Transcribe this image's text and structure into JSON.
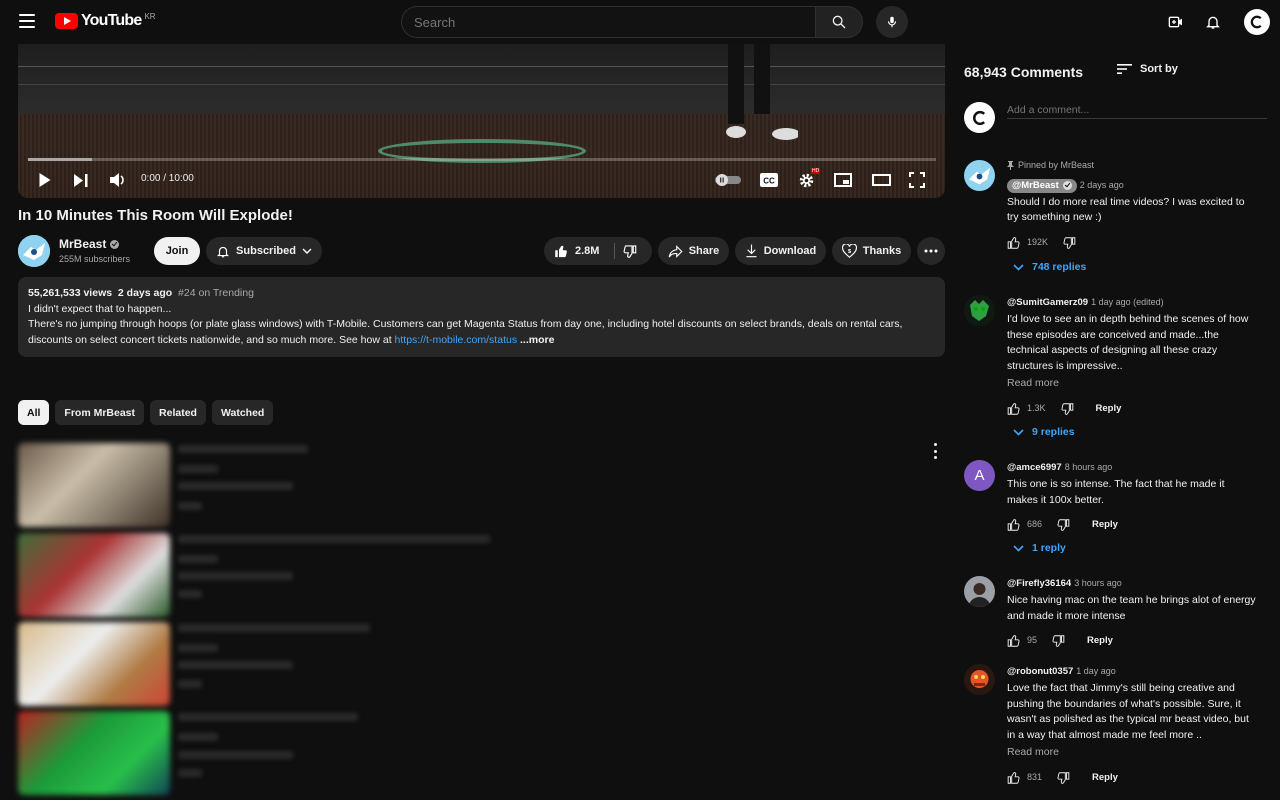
{
  "header": {
    "logo_text": "YouTube",
    "country": "KR",
    "search_placeholder": "Search"
  },
  "player": {
    "time": "0:00 / 10:00",
    "progress_fraction": 0.07,
    "hd_badge": "HD",
    "cc_label": "CC"
  },
  "video": {
    "title": "In 10 Minutes This Room Will Explode!",
    "channel": "MrBeast",
    "subscribers": "255M subscribers",
    "join_label": "Join",
    "subscribed_label": "Subscribed",
    "likes": "2.8M",
    "share_label": "Share",
    "download_label": "Download",
    "thanks_label": "Thanks"
  },
  "description": {
    "views": "55,261,533 views",
    "age": "2 days ago",
    "trending": "#24 on Trending",
    "line1": "I didn't expect that to happen...",
    "line2": "There's no jumping through hoops (or plate glass windows) with T-Mobile. Customers can get Magenta Status from day one, including hotel discounts on select brands, deals on rental cars, discounts on select concert tickets nationwide, and so much more. See how at",
    "link": "https://t-mobile.com/status",
    "more": "...more"
  },
  "chips": [
    "All",
    "From MrBeast",
    "Related",
    "Watched"
  ],
  "comments_header": {
    "count": "68,943 Comments",
    "sort_label": "Sort by",
    "add_placeholder": "Add a comment..."
  },
  "comments": [
    {
      "pinned": "Pinned by MrBeast",
      "author": "@MrBeast",
      "time": "2 days ago",
      "text": "Should I do more real time videos? I was excited to try something new :)",
      "likes": "192K",
      "replies": "748 replies"
    },
    {
      "author": "@SumitGamerz09",
      "time": "1 day ago (edited)",
      "text": "I'd love to see an in depth behind the scenes of how these episodes are conceived and made...the technical aspects of designing all these crazy structures is impressive..",
      "read_more": "Read more",
      "likes": "1.3K",
      "reply": "Reply",
      "replies": "9 replies"
    },
    {
      "author": "@amce6997",
      "time": "8 hours ago",
      "avatar_letter": "A",
      "text": "This one is so intense. The fact that he made it makes it 100x better.",
      "likes": "686",
      "reply": "Reply",
      "replies": "1 reply"
    },
    {
      "author": "@Firefly36164",
      "time": "3 hours ago",
      "text": "Nice having mac on the team he brings alot of energy and made it more intense",
      "likes": "95",
      "reply": "Reply"
    },
    {
      "author": "@robonut0357",
      "time": "1 day ago",
      "text": "Love the fact that Jimmy's still being creative and pushing the boundaries of what's possible. Sure, it wasn't as polished as the typical mr beast video, but in a way that almost made me feel more ..",
      "read_more": "Read more",
      "likes": "831",
      "reply": "Reply"
    }
  ],
  "colors": {
    "background": "#0f0f0f",
    "surface": "#272727",
    "link": "#3ea6ff",
    "brand": "#ff0000",
    "amce_avatar": "#7e57c2"
  }
}
